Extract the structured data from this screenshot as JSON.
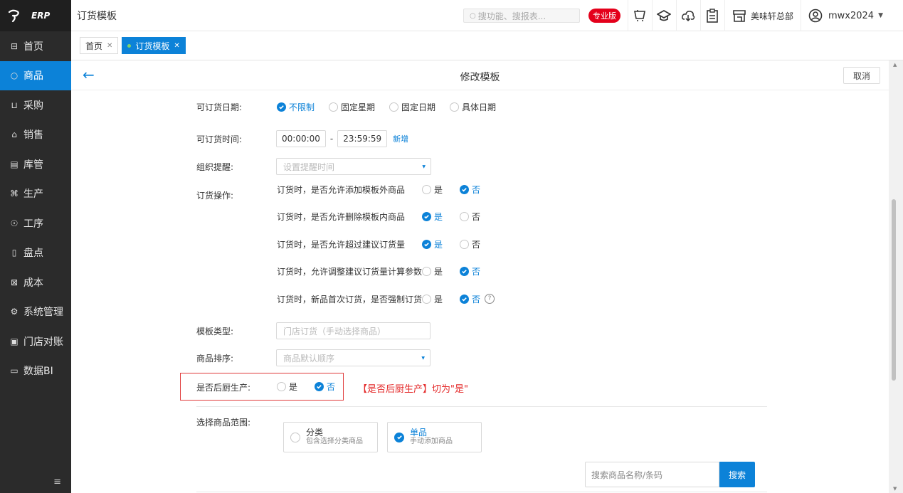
{
  "logo": {
    "text": "ERP"
  },
  "sidebar": {
    "items": [
      {
        "label": "首页",
        "glyph": "⊟",
        "icon": "dashboard-icon"
      },
      {
        "label": "商品",
        "glyph": "○",
        "icon": "goods-icon",
        "active": true
      },
      {
        "label": "采购",
        "glyph": "⊔",
        "icon": "cart-icon"
      },
      {
        "label": "销售",
        "glyph": "⌂",
        "icon": "sales-icon"
      },
      {
        "label": "库管",
        "glyph": "▤",
        "icon": "warehouse-icon"
      },
      {
        "label": "生产",
        "glyph": "⌘",
        "icon": "production-icon"
      },
      {
        "label": "工序",
        "glyph": "☉",
        "icon": "process-icon"
      },
      {
        "label": "盘点",
        "glyph": "▯",
        "icon": "inventory-icon"
      },
      {
        "label": "成本",
        "glyph": "⊠",
        "icon": "cost-icon"
      },
      {
        "label": "系统管理",
        "glyph": "⚙",
        "icon": "settings-icon"
      },
      {
        "label": "门店对账",
        "glyph": "▣",
        "icon": "reconcile-icon"
      },
      {
        "label": "数据BI",
        "glyph": "▭",
        "icon": "bi-icon"
      }
    ],
    "collapse_glyph": "≡"
  },
  "topbar": {
    "title": "订货模板",
    "search_placeholder": "搜功能、搜报表...",
    "badge": "专业版",
    "store": "美味轩总部",
    "user": "mwx2024"
  },
  "tabs": [
    {
      "label": "首页",
      "active": false
    },
    {
      "label": "订货模板",
      "active": true
    }
  ],
  "page": {
    "title": "修改模板",
    "cancel_label": "取消"
  },
  "form": {
    "order_date": {
      "label": "可订货日期:",
      "options": [
        "不限制",
        "固定星期",
        "固定日期",
        "具体日期"
      ],
      "selected": "不限制"
    },
    "order_time": {
      "label": "可订货时间:",
      "start": "00:00:00",
      "separator": "-",
      "end": "23:59:59",
      "add_label": "新增"
    },
    "reminder": {
      "label": "组织提醒:",
      "placeholder": "设置提醒时间"
    },
    "operations": {
      "label": "订货操作:",
      "yes": "是",
      "no": "否",
      "items": [
        {
          "text": "订货时，是否允许添加模板外商品",
          "selected": "否"
        },
        {
          "text": "订货时，是否允许删除模板内商品",
          "selected": "是"
        },
        {
          "text": "订货时，是否允许超过建议订货量",
          "selected": "是"
        },
        {
          "text": "订货时，允许调整建议订货量计算参数",
          "selected": "否"
        },
        {
          "text": "订货时，新品首次订货，是否强制订货",
          "selected": "否",
          "help": "?"
        }
      ]
    },
    "template_type": {
      "label": "模板类型:",
      "value": "门店订货（手动选择商品）"
    },
    "sorting": {
      "label": "商品排序:",
      "value": "商品默认顺序"
    },
    "kitchen": {
      "label": "是否后厨生产:",
      "yes": "是",
      "no": "否",
      "selected": "否",
      "note": "【是否后厨生产】切为\"是\""
    },
    "scope": {
      "label": "选择商品范围:",
      "cards": [
        {
          "title": "分类",
          "sub": "包含选择分类商品",
          "selected": false
        },
        {
          "title": "单品",
          "sub": "手动添加商品",
          "selected": true
        }
      ]
    },
    "goods_search": {
      "placeholder": "搜索商品名称/条码",
      "button": "搜索"
    }
  },
  "colors": {
    "accent": "#0c82d8",
    "sidebar_bg": "#2b2b2b",
    "badge": "#e4001b",
    "annotation": "#e42a2a"
  }
}
